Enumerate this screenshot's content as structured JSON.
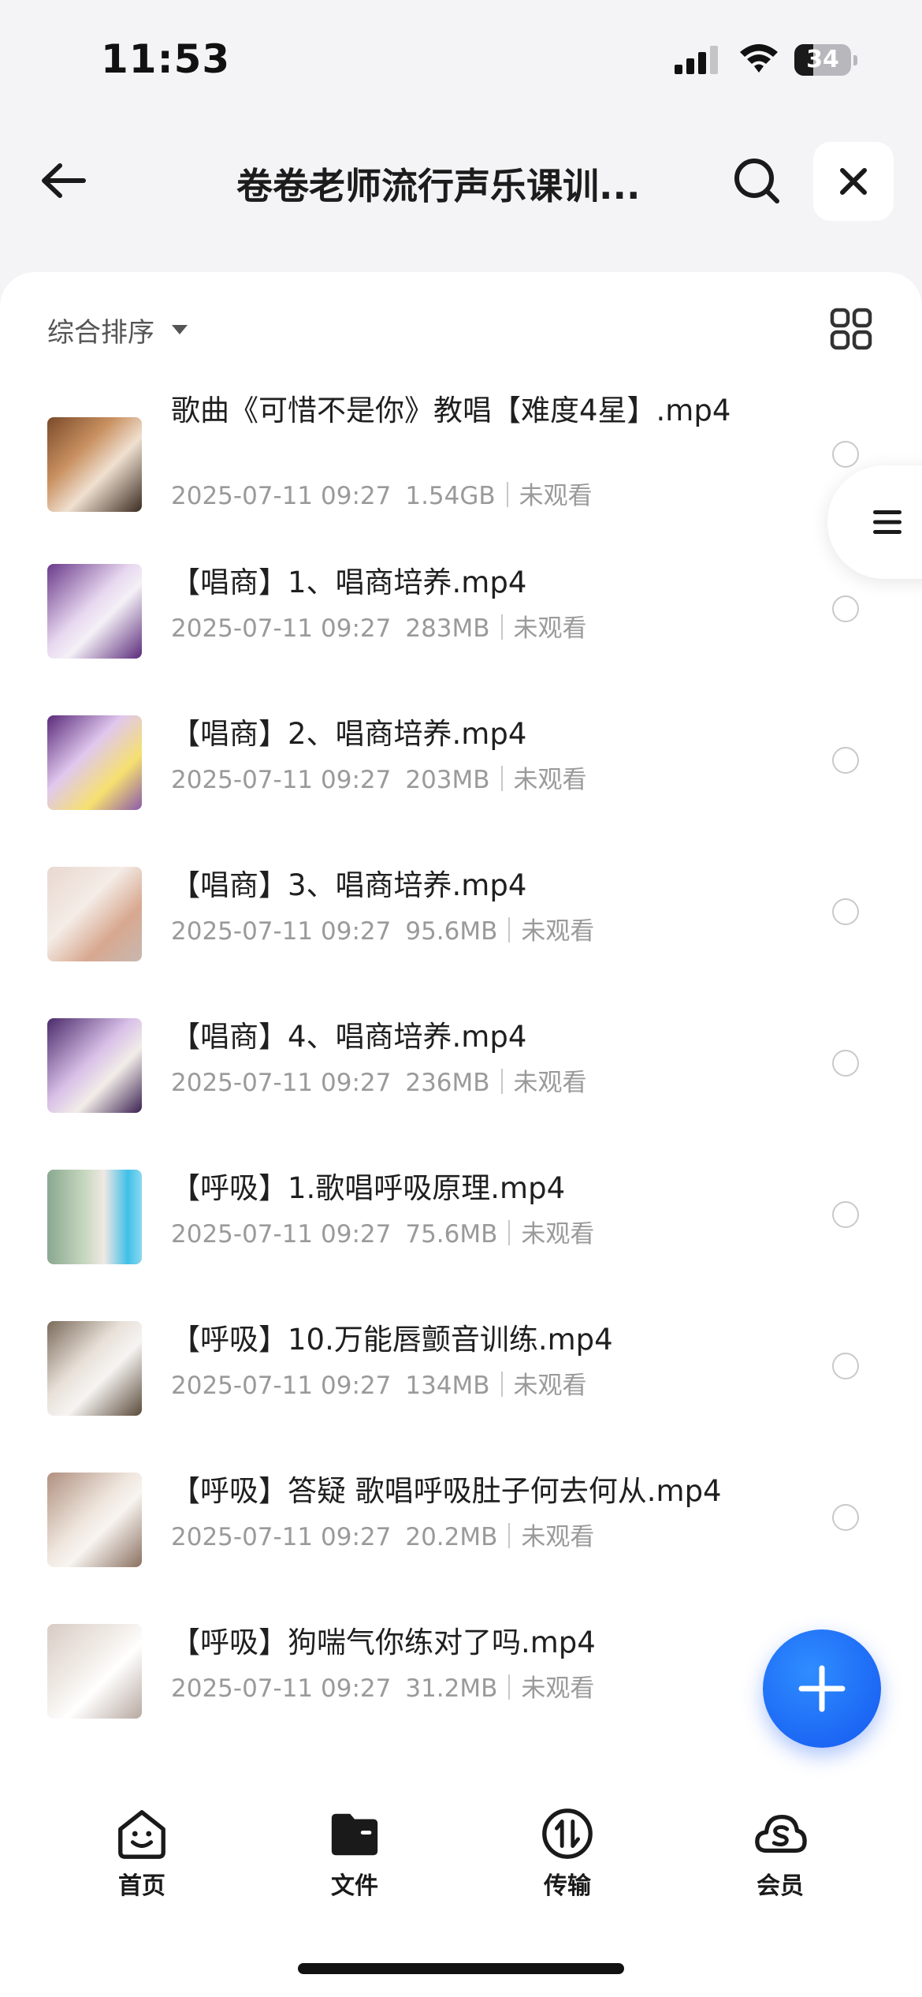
{
  "status_bar": {
    "time": "11:53",
    "battery": "34",
    "battery_level": 0.34
  },
  "header": {
    "title": "卷卷老师流行声乐课训...",
    "icons": [
      "back-arrow-icon",
      "search-icon",
      "close-icon"
    ]
  },
  "toolbar": {
    "sort_label": "综合排序",
    "view_toggle_icon": "grid-view-icon"
  },
  "files": [
    {
      "name": "歌曲《可惜不是你》教唱【难度4星】.mp4",
      "date": "2025-07-11 09:27",
      "size": "1.54GB",
      "status": "未观看"
    },
    {
      "name": "【唱商】1、唱商培养.mp4",
      "date": "2025-07-11 09:27",
      "size": "283MB",
      "status": "未观看"
    },
    {
      "name": "【唱商】2、唱商培养.mp4",
      "date": "2025-07-11 09:27",
      "size": "203MB",
      "status": "未观看"
    },
    {
      "name": "【唱商】3、唱商培养.mp4",
      "date": "2025-07-11 09:27",
      "size": "95.6MB",
      "status": "未观看"
    },
    {
      "name": "【唱商】4、唱商培养.mp4",
      "date": "2025-07-11 09:27",
      "size": "236MB",
      "status": "未观看"
    },
    {
      "name": "【呼吸】1.歌唱呼吸原理.mp4",
      "date": "2025-07-11 09:27",
      "size": "75.6MB",
      "status": "未观看"
    },
    {
      "name": "【呼吸】10.万能唇颤音训练.mp4",
      "date": "2025-07-11 09:27",
      "size": "134MB",
      "status": "未观看"
    },
    {
      "name": "【呼吸】答疑 歌唱呼吸肚子何去何从.mp4",
      "date": "2025-07-11 09:27",
      "size": "20.2MB",
      "status": "未观看"
    },
    {
      "name": "【呼吸】狗喘气你练对了吗.mp4",
      "date": "2025-07-11 09:27",
      "size": "31.2MB",
      "status": "未观看"
    }
  ],
  "bottom_nav": [
    {
      "label": "首页",
      "icon": "home-smile-icon"
    },
    {
      "label": "文件",
      "icon": "folder-icon"
    },
    {
      "label": "传输",
      "icon": "transfer-icon"
    },
    {
      "label": "会员",
      "icon": "membership-cloud-icon"
    }
  ],
  "colors": {
    "accent": "#1a63f5",
    "background": "#f4f4f6",
    "meta_text": "#9a9a9a"
  }
}
